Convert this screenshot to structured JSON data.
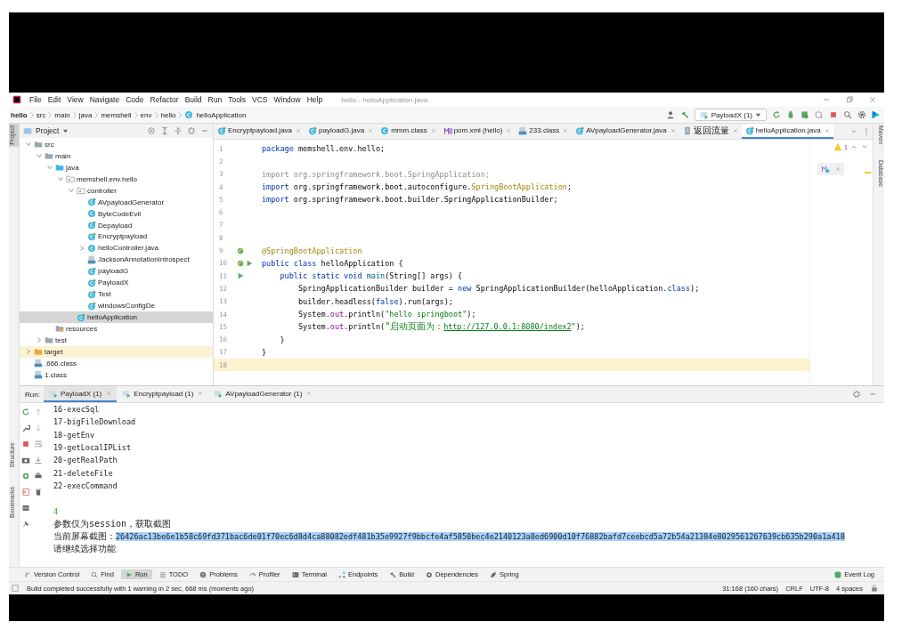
{
  "window": {
    "title": "hello - helloApplication.java"
  },
  "menu": [
    "File",
    "Edit",
    "View",
    "Navigate",
    "Code",
    "Refactor",
    "Build",
    "Run",
    "Tools",
    "VCS",
    "Window",
    "Help"
  ],
  "breadcrumb": [
    "hello",
    "src",
    "main",
    "java",
    "memshell",
    "env",
    "hello",
    "helloApplication"
  ],
  "run_config": "PayloadX (1)",
  "side_labels_left": [
    "Project",
    "Structure",
    "Bookmarks"
  ],
  "side_labels_right": [
    "Maven",
    "Database"
  ],
  "project_panel": {
    "title": "Project"
  },
  "project_tree": [
    {
      "label": "src",
      "kind": "folder",
      "expanded": true,
      "selected": false,
      "children": [
        {
          "label": "main",
          "kind": "folder",
          "expanded": true,
          "selected": false,
          "children": [
            {
              "label": "java",
              "kind": "java-folder",
              "expanded": true,
              "selected": false,
              "children": [
                {
                  "label": "memshell.env.hello",
                  "kind": "package",
                  "expanded": true,
                  "selected": false,
                  "children": [
                    {
                      "label": "controller",
                      "kind": "package",
                      "expanded": true,
                      "selected": false,
                      "children": [
                        {
                          "label": "AVpayloadGenerator",
                          "kind": "main-class",
                          "selected": false
                        },
                        {
                          "label": "ByteCodeEvil",
                          "kind": "class",
                          "selected": false
                        },
                        {
                          "label": "Depayload",
                          "kind": "main-class",
                          "selected": false
                        },
                        {
                          "label": "Encryptpayload",
                          "kind": "main-class",
                          "selected": false
                        },
                        {
                          "label": "helloController.java",
                          "kind": "class",
                          "expanded": false,
                          "selected": false
                        },
                        {
                          "label": "JacksonAnnotationIntrospect",
                          "kind": "binary",
                          "selected": false
                        },
                        {
                          "label": "payloadG",
                          "kind": "main-class",
                          "selected": false
                        },
                        {
                          "label": "PayloadX",
                          "kind": "main-class",
                          "selected": false
                        },
                        {
                          "label": "Test",
                          "kind": "main-class",
                          "selected": false
                        },
                        {
                          "label": "windowsConfigDe",
                          "kind": "main-class",
                          "selected": false
                        }
                      ]
                    },
                    {
                      "label": "helloApplication",
                      "kind": "main-class",
                      "selected": true
                    }
                  ]
                }
              ]
            },
            {
              "label": "resources",
              "kind": "resources",
              "selected": false
            }
          ]
        },
        {
          "label": "test",
          "kind": "folder",
          "expanded": false,
          "selected": false
        }
      ]
    },
    {
      "label": "target",
      "kind": "target",
      "expanded": false,
      "selected": false
    },
    {
      "label": ".666.class",
      "kind": "binary",
      "selected": false
    },
    {
      "label": "1.class",
      "kind": "binary",
      "selected": false
    }
  ],
  "editor_tabs": [
    {
      "label": "Encryptpayload.java",
      "kind": "main-class",
      "selected": false
    },
    {
      "label": "payloadG.java",
      "kind": "main-class",
      "selected": false
    },
    {
      "label": "mmm.class",
      "kind": "class",
      "selected": false
    },
    {
      "label": "pom.xml (hello)",
      "kind": "maven",
      "selected": false
    },
    {
      "label": "233.class",
      "kind": "binary",
      "selected": false
    },
    {
      "label": "AVpayloadGenerator.java",
      "kind": "main-class",
      "selected": false
    },
    {
      "label": "返回流量",
      "kind": "file",
      "selected": false
    },
    {
      "label": "helloApplication.java",
      "kind": "main-class",
      "selected": true
    }
  ],
  "editor": {
    "warning_count": "1",
    "lines": [
      {
        "number": "1",
        "current": false,
        "bean": false,
        "run": false,
        "tokens": [
          {
            "kind": "keyword",
            "text": "package"
          },
          {
            "kind": "plain",
            "text": " memshell.env.hello;"
          }
        ]
      },
      {
        "number": "2",
        "current": false,
        "bean": false,
        "run": false
      },
      {
        "number": "3",
        "current": false,
        "bean": false,
        "run": false,
        "tokens": [
          {
            "kind": "faded",
            "text": "import org.springframework.boot.SpringApplication;"
          }
        ]
      },
      {
        "number": "4",
        "current": false,
        "bean": false,
        "run": false,
        "tokens": [
          {
            "kind": "keyword",
            "text": "import"
          },
          {
            "kind": "plain",
            "text": " org.springframework.boot.autoconfigure."
          },
          {
            "kind": "annotation",
            "text": "SpringBootApplication"
          },
          {
            "kind": "plain",
            "text": ";"
          }
        ]
      },
      {
        "number": "5",
        "current": false,
        "bean": false,
        "run": false,
        "tokens": [
          {
            "kind": "keyword",
            "text": "import"
          },
          {
            "kind": "plain",
            "text": " org.springframework.boot.builder.SpringApplicationBuilder;"
          }
        ]
      },
      {
        "number": "6",
        "current": false,
        "bean": false,
        "run": false
      },
      {
        "number": "7",
        "current": false,
        "bean": false,
        "run": false
      },
      {
        "number": "8",
        "current": false,
        "bean": false,
        "run": false
      },
      {
        "number": "9",
        "current": false,
        "bean": true,
        "run": false,
        "tokens": [
          {
            "kind": "annotation",
            "text": "@SpringBootApplication"
          }
        ]
      },
      {
        "number": "10",
        "current": false,
        "bean": true,
        "run": true,
        "tokens": [
          {
            "kind": "keyword",
            "text": "public class"
          },
          {
            "kind": "plain",
            "text": " helloApplication {"
          }
        ]
      },
      {
        "number": "11",
        "current": false,
        "bean": false,
        "run": true,
        "tokens": [
          {
            "kind": "keyword",
            "text": "    public static void"
          },
          {
            "kind": "method",
            "text": " main"
          },
          {
            "kind": "plain",
            "text": "(String[] args) {"
          }
        ]
      },
      {
        "number": "12",
        "current": false,
        "bean": false,
        "run": false,
        "tokens": [
          {
            "kind": "plain",
            "text": "        SpringApplicationBuilder builder = "
          },
          {
            "kind": "keyword",
            "text": "new"
          },
          {
            "kind": "plain",
            "text": " SpringApplicationBuilder(helloApplication."
          },
          {
            "kind": "keyword",
            "text": "class"
          },
          {
            "kind": "plain",
            "text": ");"
          }
        ]
      },
      {
        "number": "13",
        "current": false,
        "bean": false,
        "run": false,
        "tokens": [
          {
            "kind": "plain",
            "text": "        builder.headless("
          },
          {
            "kind": "keyword",
            "text": "false"
          },
          {
            "kind": "plain",
            "text": ").run(args);"
          }
        ]
      },
      {
        "number": "14",
        "current": false,
        "bean": false,
        "run": false,
        "tokens": [
          {
            "kind": "plain",
            "text": "        System."
          },
          {
            "kind": "field",
            "text": "out"
          },
          {
            "kind": "plain",
            "text": ".println("
          },
          {
            "kind": "string",
            "text": "\"hello springboot\""
          },
          {
            "kind": "plain",
            "text": ");"
          }
        ]
      },
      {
        "number": "15",
        "current": false,
        "bean": false,
        "run": false,
        "tokens": [
          {
            "kind": "plain",
            "text": "        System."
          },
          {
            "kind": "field",
            "text": "out"
          },
          {
            "kind": "plain",
            "text": ".println("
          },
          {
            "kind": "string",
            "text": "\"启动页面为："
          },
          {
            "kind": "link",
            "text": "http://127.0.0.1:8080/index2"
          },
          {
            "kind": "string",
            "text": "\""
          },
          {
            "kind": "plain",
            "text": ");"
          }
        ]
      },
      {
        "number": "16",
        "current": false,
        "bean": false,
        "run": false,
        "tokens": [
          {
            "kind": "plain",
            "text": "    }"
          }
        ]
      },
      {
        "number": "17",
        "current": false,
        "bean": false,
        "run": false,
        "tokens": [
          {
            "kind": "plain",
            "text": "}"
          }
        ]
      },
      {
        "number": "18",
        "current": true,
        "bean": false,
        "run": false
      }
    ]
  },
  "run_panel": {
    "label": "Run:",
    "tabs": [
      {
        "label": "PayloadX (1)",
        "selected": true
      },
      {
        "label": "Encryptpayload (1)",
        "selected": false
      },
      {
        "label": "AVpayloadGenerator (1)",
        "selected": false
      }
    ],
    "lines": [
      {
        "kind": "output",
        "text": "16-execSql"
      },
      {
        "kind": "output",
        "text": "17-bigFileDownload"
      },
      {
        "kind": "output",
        "text": "18-getEnv"
      },
      {
        "kind": "output",
        "text": "19-getLocalIPList"
      },
      {
        "kind": "output",
        "text": "20-getRealPath"
      },
      {
        "kind": "output",
        "text": "21-deleteFile"
      },
      {
        "kind": "output",
        "text": "22-execCommand"
      },
      {
        "kind": "blank"
      },
      {
        "kind": "input",
        "text": "4"
      },
      {
        "kind": "output",
        "text": "参数仅为session，获取截图"
      },
      {
        "kind": "highlighted",
        "text": "当前屏幕截图：",
        "highlight": "26426ac13be6e1b58c69fd371bac6de01f70ec6d8d4ca88082edf481b35e9927f9bbcfe4af5850bec4e2140123a8ed6900d10f76882bafd7ceebcd5a72b54a21384e8029561267639cb635b290a1a418"
      },
      {
        "kind": "output",
        "text": "请继续选择功能"
      }
    ]
  },
  "tool_windows": [
    {
      "label": "Version Control",
      "selected": false
    },
    {
      "label": "Find",
      "selected": false
    },
    {
      "label": "Run",
      "selected": true
    },
    {
      "label": "TODO",
      "selected": false
    },
    {
      "label": "Problems",
      "selected": false
    },
    {
      "label": "Profiler",
      "selected": false
    },
    {
      "label": "Terminal",
      "selected": false
    },
    {
      "label": "Endpoints",
      "selected": false
    },
    {
      "label": "Build",
      "selected": false
    },
    {
      "label": "Dependencies",
      "selected": false
    },
    {
      "label": "Spring",
      "selected": false
    }
  ],
  "event_log": {
    "label": "Event Log"
  },
  "status_bar": {
    "message": "Build completed successfully with 1 warning in 2 sec, 668 ms (moments ago)",
    "position": "31:168 (160 chars)",
    "line_ending": "CRLF",
    "encoding": "UTF-8",
    "indent": "4 spaces"
  }
}
